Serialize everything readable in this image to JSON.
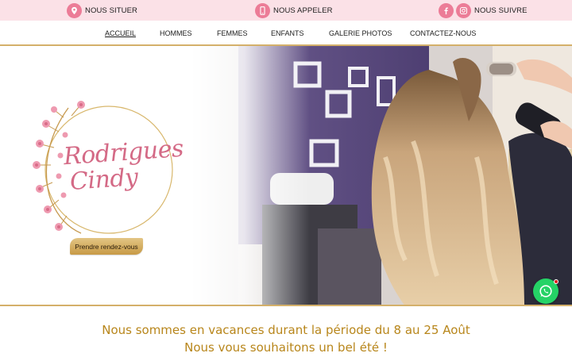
{
  "topbar": {
    "locate_label": "NOUS SITUER",
    "call_label": "NOUS APPELER",
    "follow_label": "NOUS SUIVRE",
    "icons": [
      "map-pin-icon",
      "phone-icon",
      "facebook-icon",
      "instagram-icon"
    ],
    "background": "#fbe1e7",
    "icon_color": "#ec7c97"
  },
  "nav": {
    "items": [
      {
        "label": "ACCUEIL",
        "active": true
      },
      {
        "label": "HOMMES",
        "active": false
      },
      {
        "label": "FEMMES",
        "active": false
      },
      {
        "label": "ENFANTS",
        "active": false
      },
      {
        "label": "GALERIE PHOTOS",
        "active": false
      },
      {
        "label": "CONTACTEZ-NOUS",
        "active": false
      }
    ],
    "accent": "#d4b06a"
  },
  "hero": {
    "logo_line1": "Rodrigues",
    "logo_line2": "Cindy",
    "cta_label": "Prendre rendez-vous",
    "logo_color": "#d46a86",
    "cta_color": "#d7b26a"
  },
  "message": {
    "line1": "Nous sommes en vacances durant la période du 8 au 25 Août",
    "line2": "Nous vous souhaitons un bel été !",
    "color": "#b8861b"
  },
  "whatsapp": {
    "icon": "whatsapp-icon",
    "color": "#25d366"
  }
}
